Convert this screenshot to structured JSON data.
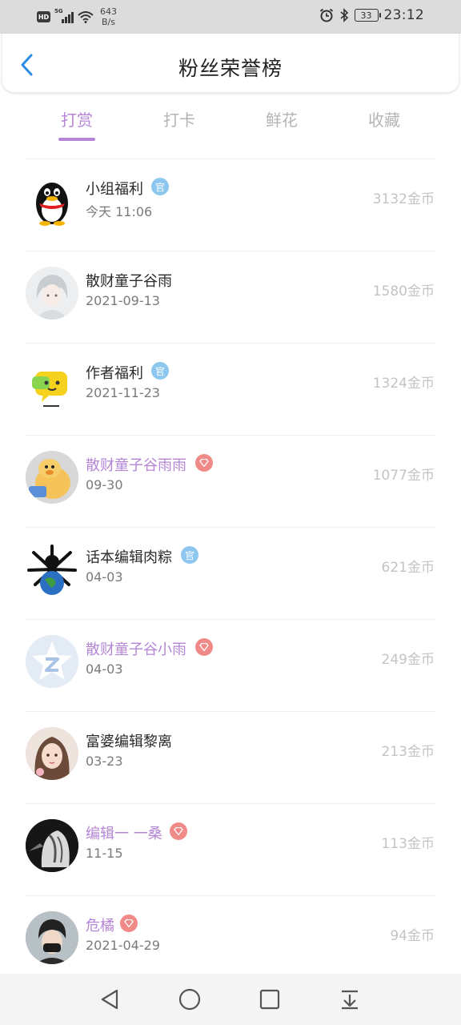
{
  "status_bar": {
    "hd": "HD",
    "network": "5G",
    "speed_value": "643",
    "speed_unit": "B/s",
    "battery": "33",
    "time": "23:12"
  },
  "header": {
    "title": "粉丝荣誉榜",
    "back_icon": "chevron-left-icon"
  },
  "tabs": [
    {
      "label": "打赏",
      "active": true
    },
    {
      "label": "打卡",
      "active": false
    },
    {
      "label": "鲜花",
      "active": false
    },
    {
      "label": "收藏",
      "active": false
    }
  ],
  "colors": {
    "accent": "#b585d6",
    "official_badge": "#8dc6ef",
    "gem_badge": "#f08a88",
    "amount": "#c4c4c4"
  },
  "entries": [
    {
      "name": "小组福利",
      "badge": "官",
      "badge_type": "official",
      "date": "今天 11:06",
      "amount": "3132金币",
      "vip": false,
      "avatar": "penguin-avatar"
    },
    {
      "name": "散财童子谷雨",
      "badge": "",
      "badge_type": "none",
      "date": "2021-09-13",
      "amount": "1580金币",
      "vip": false,
      "avatar": "anime-girl-avatar"
    },
    {
      "name": "作者福利",
      "badge": "官",
      "badge_type": "official",
      "date": "2021-11-23",
      "amount": "1324金币",
      "vip": false,
      "avatar": "chat-bubble-avatar"
    },
    {
      "name": "散财童子谷雨雨",
      "badge": "",
      "badge_type": "gem",
      "date": "09-30",
      "amount": "1077金币",
      "vip": true,
      "avatar": "duck-avatar"
    },
    {
      "name": "话本编辑肉粽",
      "badge": "官",
      "badge_type": "official",
      "date": "04-03",
      "amount": "621金币",
      "vip": false,
      "avatar": "earth-avatar"
    },
    {
      "name": "散财童子谷小雨",
      "badge": "",
      "badge_type": "gem",
      "date": "04-03",
      "amount": "249金币",
      "vip": true,
      "avatar": "star-avatar"
    },
    {
      "name": "富婆编辑黎离",
      "badge": "",
      "badge_type": "none",
      "date": "03-23",
      "amount": "213金币",
      "vip": false,
      "avatar": "woman-avatar"
    },
    {
      "name": "编辑一 一桑",
      "badge": "",
      "badge_type": "gem",
      "date": "11-15",
      "amount": "113金币",
      "vip": true,
      "avatar": "dark-figure-avatar"
    },
    {
      "name": "危橘",
      "badge": "",
      "badge_type": "gem",
      "date": "2021-04-29",
      "amount": "94金币",
      "vip": true,
      "avatar": "masked-boy-avatar"
    }
  ],
  "navbar": {
    "buttons": [
      "back-triangle-icon",
      "home-circle-icon",
      "recents-square-icon",
      "notification-pull-icon"
    ]
  }
}
